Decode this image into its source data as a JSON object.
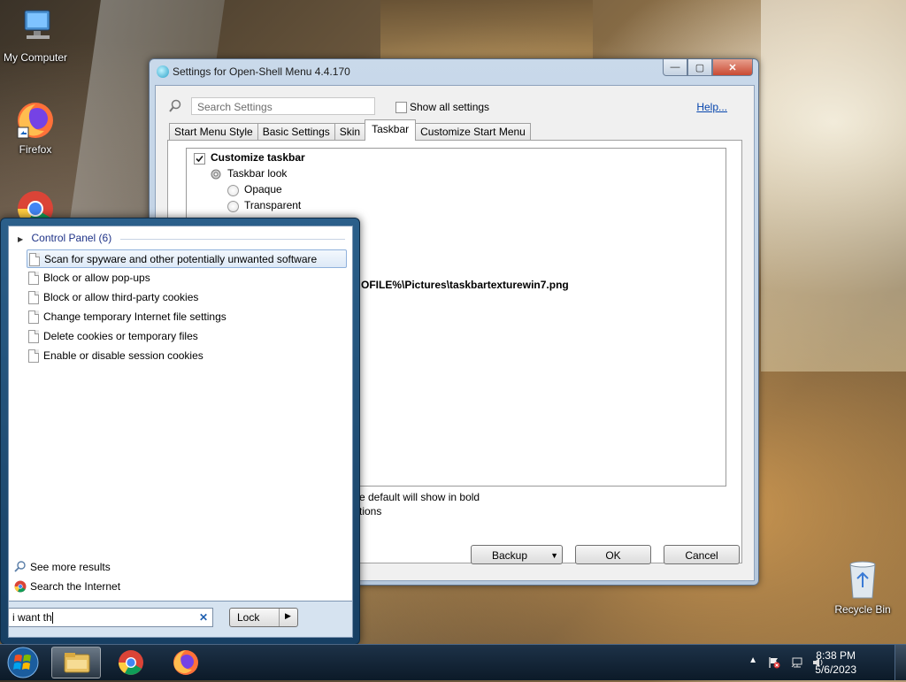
{
  "desktop": {
    "icons": [
      {
        "label": "My Computer",
        "icon": "computer-icon"
      },
      {
        "label": "Firefox",
        "icon": "firefox-icon"
      },
      {
        "label": "Recycle Bin",
        "icon": "recycle-bin-icon"
      }
    ]
  },
  "settings_window": {
    "title": "Settings for Open-Shell Menu 4.4.170",
    "search_placeholder": "Search Settings",
    "show_all_label": "Show all settings",
    "show_all_checked": false,
    "help_label": "Help...",
    "tabs": [
      "Start Menu Style",
      "Basic Settings",
      "Skin",
      "Taskbar",
      "Customize Start Menu"
    ],
    "active_tab": "Taskbar",
    "tree": {
      "customize_taskbar": "Customize taskbar",
      "customize_taskbar_checked": true,
      "taskbar_look": "Taskbar look",
      "opaque": "Opaque",
      "transparent": "Transparent",
      "texture_path_partial": "OFILE%\\Pictures\\taskbartexturewin7.png"
    },
    "footer_text_1": "e default will show in bold",
    "footer_text_2": "tions",
    "buttons": {
      "backup": "Backup",
      "ok": "OK",
      "cancel": "Cancel"
    }
  },
  "start_menu": {
    "group_header": "Control Panel (6)",
    "results": [
      "Scan for spyware and other potentially unwanted software",
      "Block or allow pop-ups",
      "Block or allow third-party cookies",
      "Change temporary Internet file settings",
      "Delete cookies or temporary files",
      "Enable or disable session cookies"
    ],
    "selected_index": 0,
    "see_more": "See more results",
    "search_internet": "Search the Internet",
    "search_value": "i want th",
    "lock_label": "Lock"
  },
  "taskbar": {
    "time": "8:38 PM",
    "date": "5/6/2023",
    "pinned": [
      "file-explorer-icon",
      "chrome-icon",
      "firefox-icon"
    ]
  }
}
